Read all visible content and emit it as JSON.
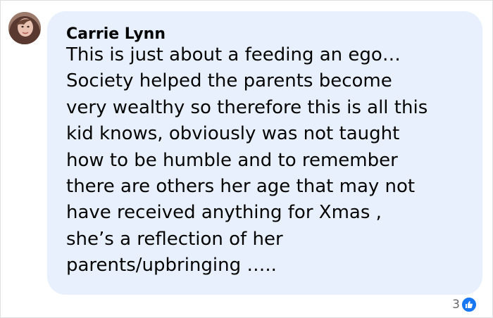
{
  "comment": {
    "author": "Carrie Lynn",
    "lines": [
      "This is just about a feeding an ego…",
      "Society helped the parents become",
      "very wealthy so therefore this is all this",
      "kid knows, obviously was not taught",
      "how to be humble and to remember",
      "there are others her age that may not",
      "have received anything for Xmas ,",
      "she’s a reflection of her",
      "parents/upbringing ….."
    ],
    "reaction_count": "3",
    "reaction_icon": "like-icon"
  },
  "colors": {
    "bubble": "#e7f0fc",
    "text": "#050505",
    "like": "#1877f2",
    "muted": "#65676b"
  }
}
